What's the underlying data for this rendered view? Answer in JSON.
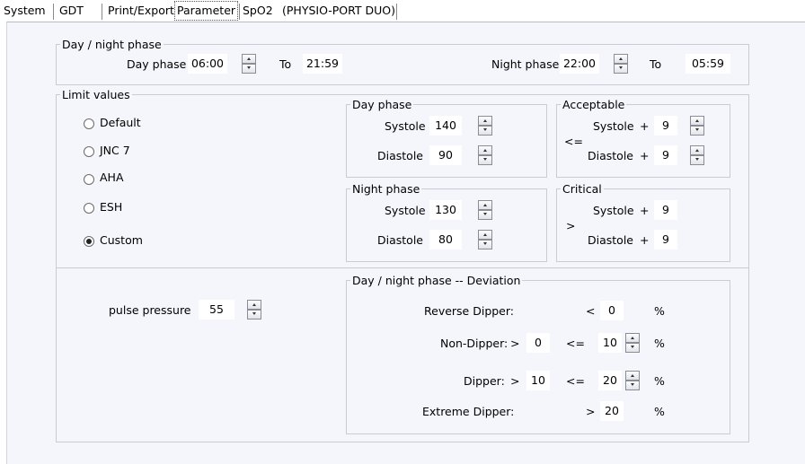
{
  "tabs": [
    "System",
    "GDT",
    "Print/Export",
    "Parameter",
    "SpO2",
    "(PHYSIO-PORT DUO)"
  ],
  "day_night": {
    "legend": "Day / night phase",
    "day_label": "Day phase",
    "day_from": "06:00",
    "to1": "To",
    "day_to": "21:59",
    "night_label": "Night phase",
    "night_from": "22:00",
    "to2": "To",
    "night_to": "05:59"
  },
  "limits": {
    "legend": "Limit values",
    "options": [
      "Default",
      "JNC 7",
      "AHA",
      "ESH",
      "Custom"
    ],
    "selected": "Custom",
    "day": {
      "legend": "Day phase",
      "systole_label": "Systole",
      "systole": "140",
      "diastole_label": "Diastole",
      "diastole": "90"
    },
    "night": {
      "legend": "Night phase",
      "systole_label": "Systole",
      "systole": "130",
      "diastole_label": "Diastole",
      "diastole": "80"
    },
    "acceptable": {
      "legend": "Acceptable",
      "op": "<=",
      "systole_label": "Systole",
      "plus1": "+",
      "systole": "9",
      "diastole_label": "Diastole",
      "plus2": "+",
      "diastole": "9"
    },
    "critical": {
      "legend": "Critical",
      "op": ">",
      "systole_label": "Systole",
      "plus1": "+",
      "systole": "9",
      "diastole_label": "Diastole",
      "plus2": "+",
      "diastole": "9"
    }
  },
  "pulse": {
    "label": "pulse pressure",
    "value": "55"
  },
  "deviation": {
    "legend": "Day / night phase -- Deviation",
    "reverse_label": "Reverse Dipper:",
    "reverse_op": "<",
    "reverse_val": "0",
    "pct1": "%",
    "non_label": "Non-Dipper:",
    "non_gt": ">",
    "non_lo": "0",
    "non_le": "<=",
    "non_hi": "10",
    "pct2": "%",
    "dip_label": "Dipper:",
    "dip_gt": ">",
    "dip_lo": "10",
    "dip_le": "<=",
    "dip_hi": "20",
    "pct3": "%",
    "ext_label": "Extreme Dipper:",
    "ext_op": ">",
    "ext_val": "20",
    "pct4": "%"
  }
}
